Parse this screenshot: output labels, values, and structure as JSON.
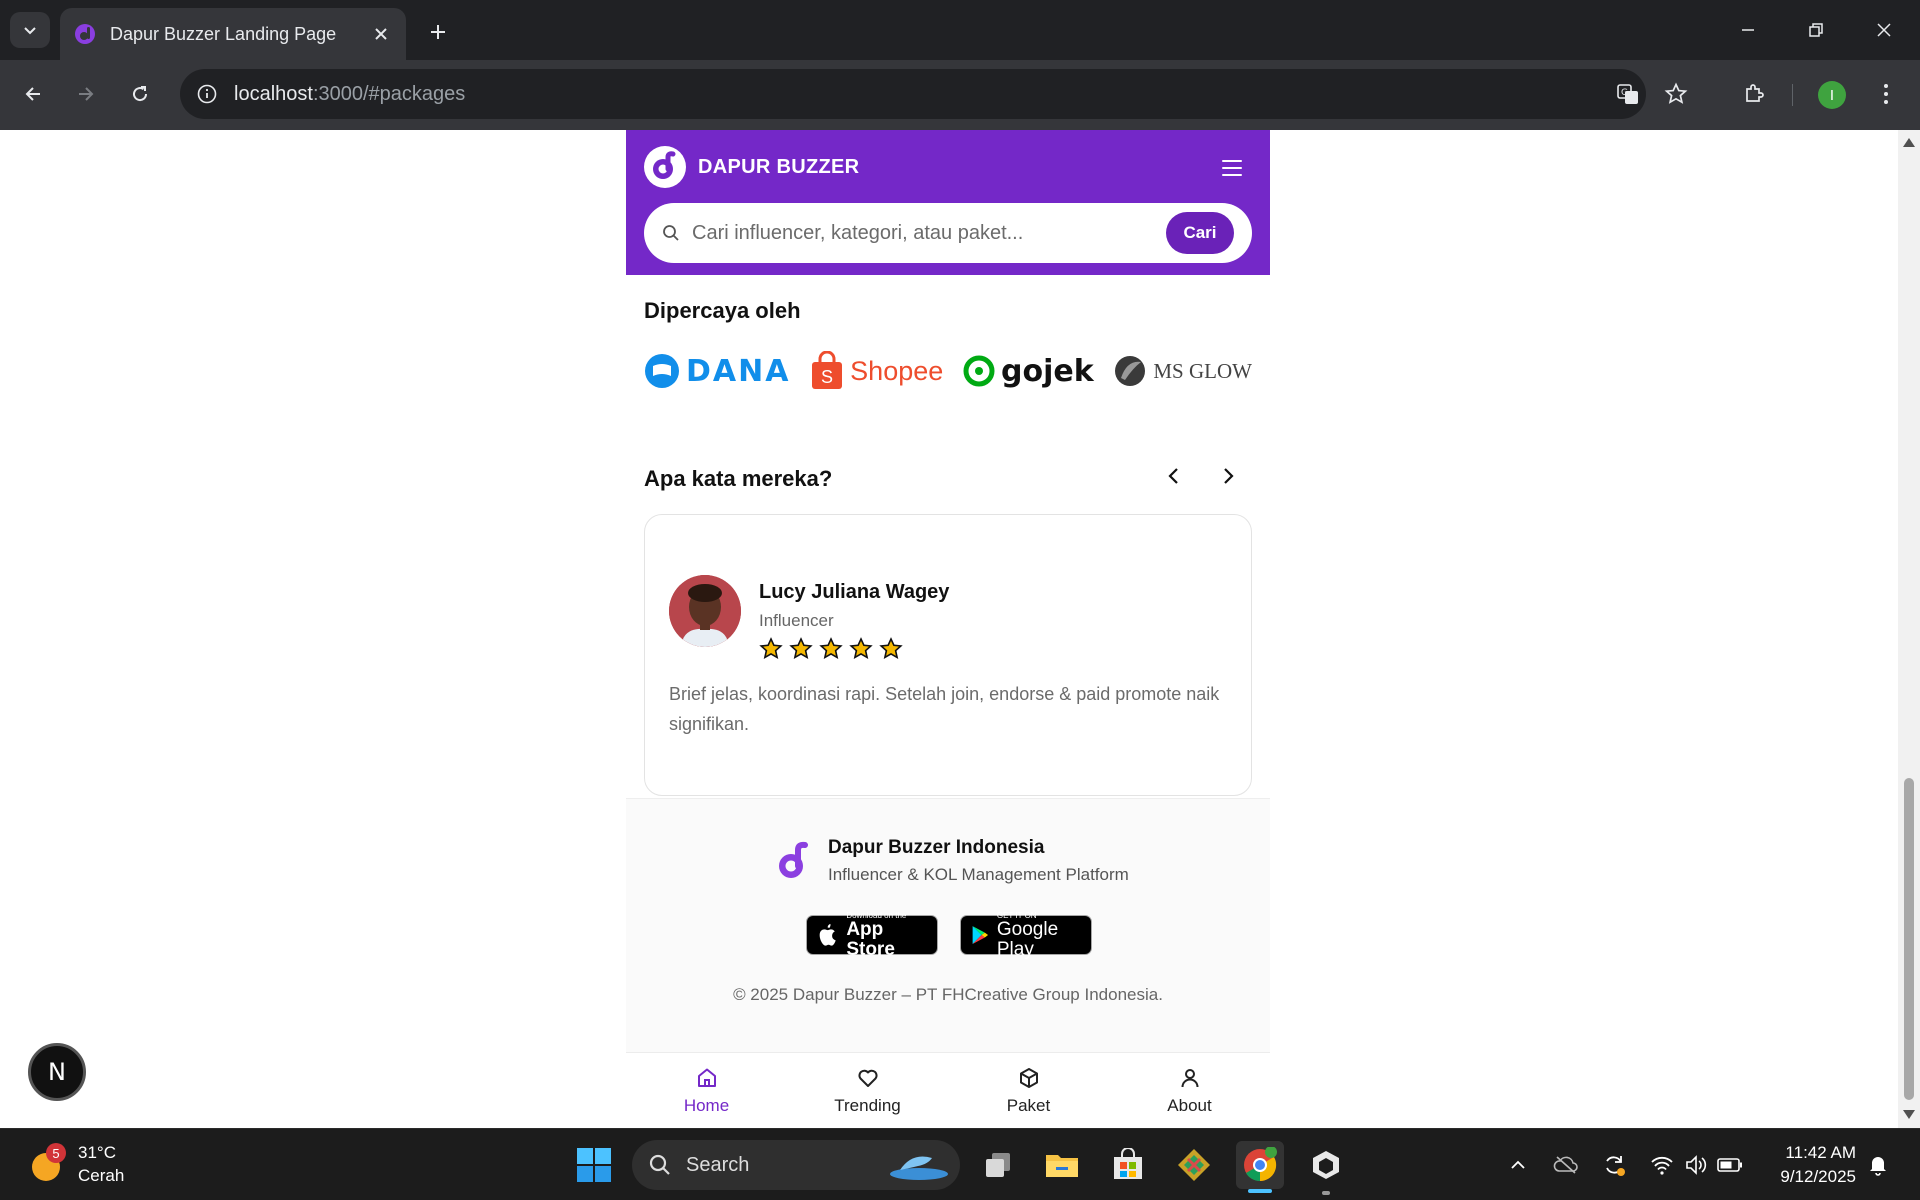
{
  "browser": {
    "tab_title": "Dapur Buzzer Landing Page",
    "url_host": "localhost",
    "url_rest": ":3000/#packages",
    "profile_initial": "I"
  },
  "header": {
    "brand_name": "DAPUR BUZZER",
    "search_placeholder": "Cari influencer, kategori, atau paket...",
    "search_button": "Cari"
  },
  "trusted": {
    "title": "Dipercaya oleh",
    "logos": [
      "DANA",
      "Shopee",
      "gojek",
      "MS GLOW"
    ]
  },
  "testimonials": {
    "title": "Apa kata mereka?",
    "current": {
      "name": "Lucy Juliana Wagey",
      "role": "Influencer",
      "rating": 5,
      "quote": "Brief jelas, koordinasi rapi. Setelah join, endorse & paid promote naik signifikan."
    }
  },
  "footer": {
    "company": "Dapur Buzzer Indonesia",
    "tagline": "Influencer & KOL Management Platform",
    "appstore_small": "Download on the",
    "appstore_big": "App Store",
    "googleplay_small": "GET IT ON",
    "googleplay_big": "Google Play",
    "copyright": "© 2025 Dapur Buzzer – PT FHCreative Group Indonesia."
  },
  "bottom_nav": [
    {
      "label": "Home",
      "icon": "home-icon",
      "active": true
    },
    {
      "label": "Trending",
      "icon": "heart-icon",
      "active": false
    },
    {
      "label": "Paket",
      "icon": "package-icon",
      "active": false
    },
    {
      "label": "About",
      "icon": "user-icon",
      "active": false
    }
  ],
  "nextjs_badge": "N",
  "taskbar": {
    "weather_temp": "31°C",
    "weather_desc": "Cerah",
    "weather_badge": "5",
    "search_label": "Search",
    "time": "11:42 AM",
    "date": "9/12/2025"
  },
  "colors": {
    "brand_purple": "#7428c8",
    "button_purple": "#6a22b8",
    "star_yellow": "#f5b800"
  }
}
